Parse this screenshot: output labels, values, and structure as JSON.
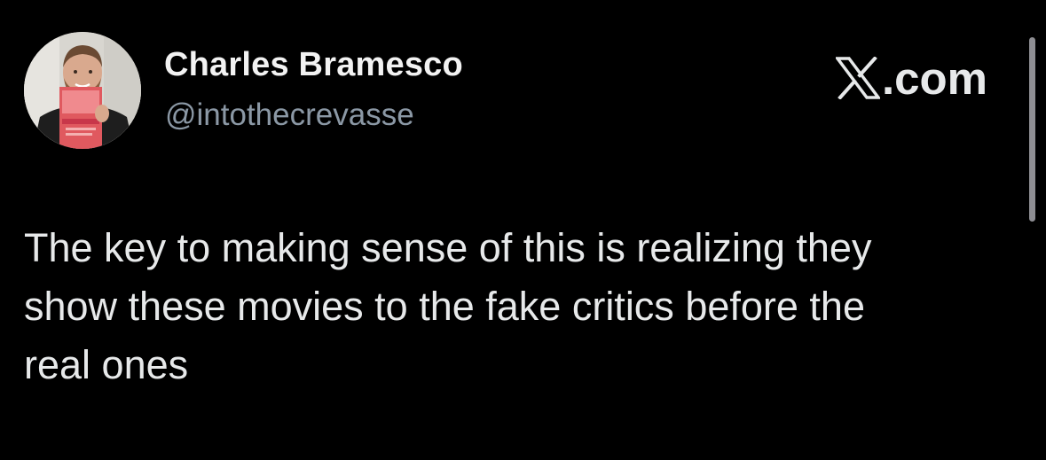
{
  "author": {
    "display_name": "Charles Bramesco",
    "handle": "@intothecrevasse",
    "avatar_book_title": "COLORS OF FILM"
  },
  "brand": {
    "label": ".com",
    "icon": "x-logo-icon"
  },
  "tweet": {
    "text": "The key to making sense of this is realizing they\nshow these movies to the fake critics before the\nreal ones"
  },
  "colors": {
    "background": "#000000",
    "primary_text": "#e7e9ea",
    "secondary_text": "#8b98a5",
    "scrollbar": "#8e8e93"
  }
}
